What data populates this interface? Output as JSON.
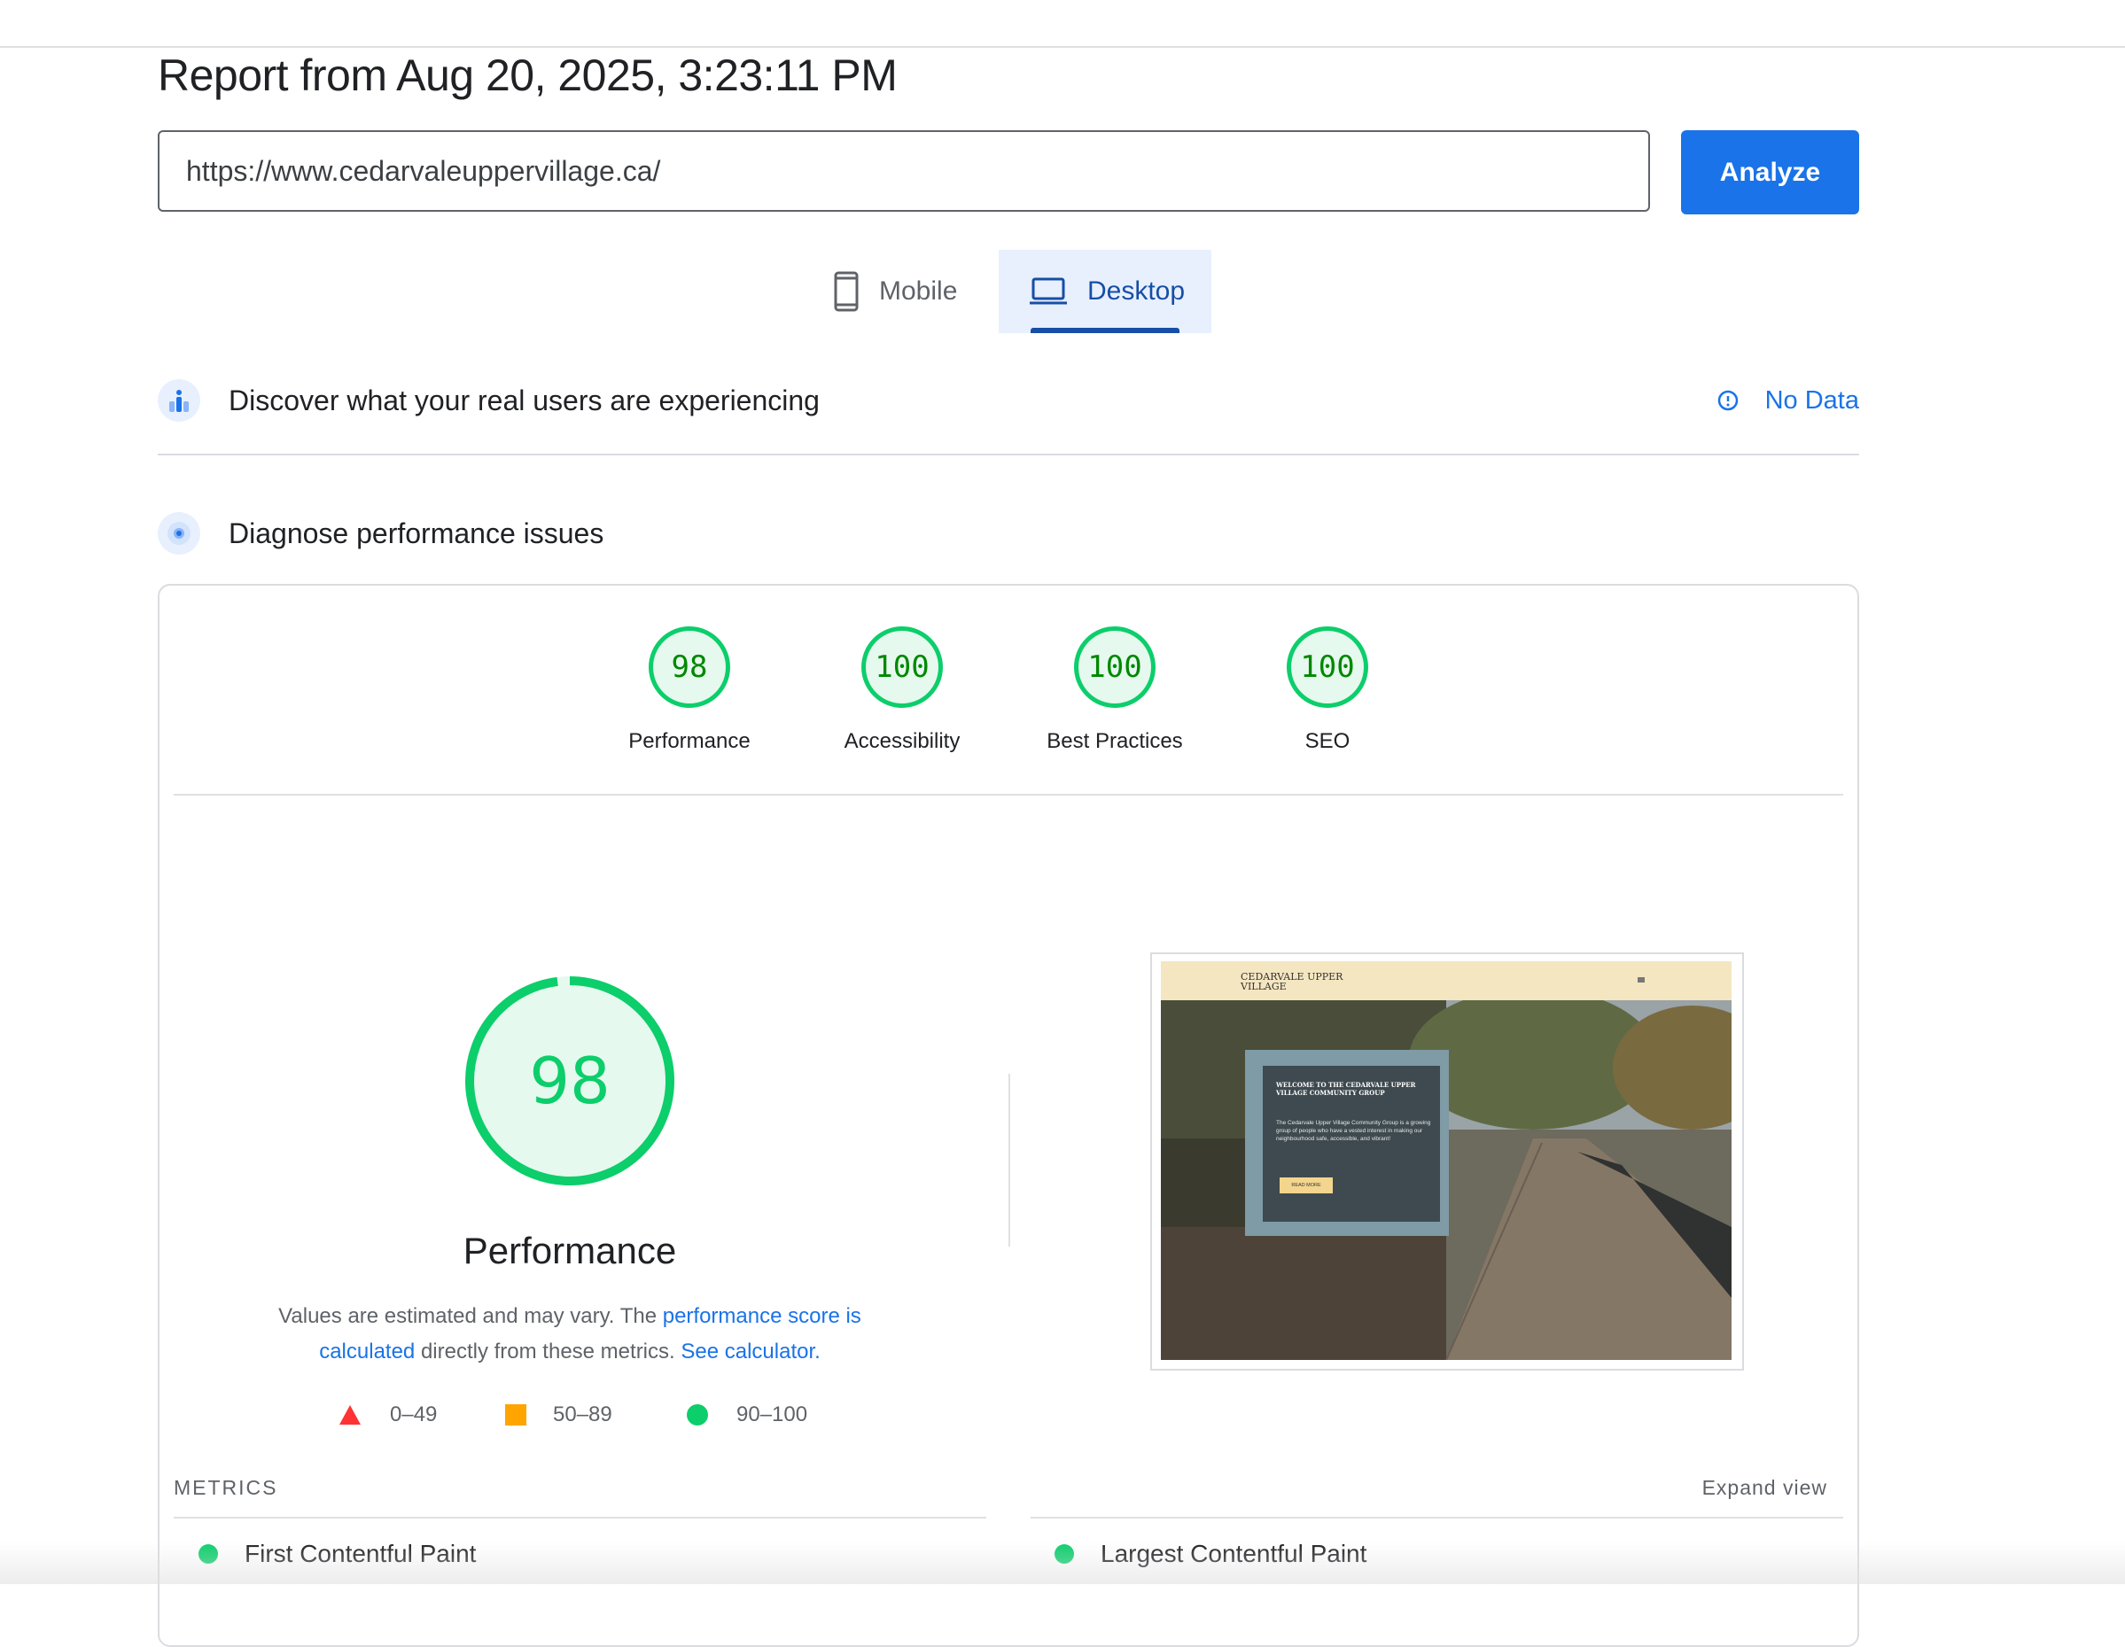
{
  "report": {
    "title": "Report from Aug 20, 2025, 3:23:11 PM"
  },
  "url_input": {
    "value": "https://www.cedarvaleuppervillage.ca/"
  },
  "analyze_label": "Analyze",
  "tabs": [
    {
      "label": "Mobile",
      "icon": "phone-icon",
      "selected": false
    },
    {
      "label": "Desktop",
      "icon": "laptop-icon",
      "selected": true
    }
  ],
  "field_data": {
    "title": "Discover what your real users are experiencing",
    "status": "No Data"
  },
  "lab_data": {
    "title": "Diagnose performance issues"
  },
  "scores": [
    {
      "value": "98",
      "label": "Performance"
    },
    {
      "value": "100",
      "label": "Accessibility"
    },
    {
      "value": "100",
      "label": "Best Practices"
    },
    {
      "value": "100",
      "label": "SEO"
    }
  ],
  "performance": {
    "score": "98",
    "score_fraction": 0.98,
    "title": "Performance",
    "desc_1": "Values are estimated and may vary. The ",
    "desc_link_1": "performance score is calculated",
    "desc_2": " directly from these metrics. ",
    "desc_link_2": "See calculator.",
    "legend": [
      "0–49",
      "50–89",
      "90–100"
    ]
  },
  "screenshot": {
    "brand": "CEDARVALE UPPER VILLAGE",
    "heading": "WELCOME TO THE CEDARVALE UPPER VILLAGE COMMUNITY GROUP",
    "body": "The Cedarvale Upper Village Community Group is a growing group of people who have a vested interest in making our neighbourhood safe, accessible, and vibrant!",
    "button": "READ MORE"
  },
  "metrics": {
    "title": "METRICS",
    "expand": "Expand view",
    "items": [
      "First Contentful Paint",
      "Largest Contentful Paint"
    ]
  },
  "colors": {
    "accent": "#1a73e8",
    "pass": "#0cce6b",
    "average": "#ffa400",
    "fail": "#ff3333"
  }
}
